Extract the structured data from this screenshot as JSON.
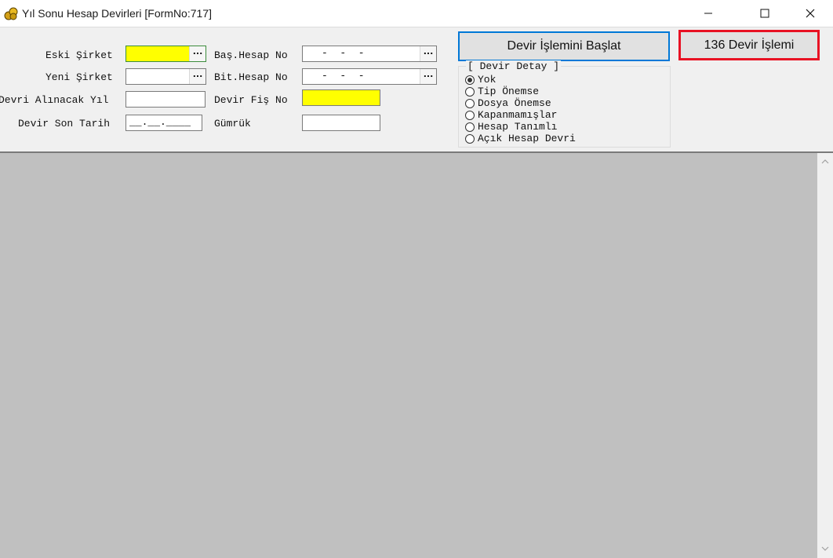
{
  "window": {
    "title": "Yıl Sonu Hesap Devirleri [FormNo:717]",
    "minimize_glyph": "—",
    "maximize_glyph": "☐",
    "close_glyph": "✕"
  },
  "form": {
    "eski_sirket_label": "Eski Şirket",
    "yeni_sirket_label": "Yeni Şirket",
    "devri_alinacak_yil_label": "Devri Alınacak Yıl",
    "devir_son_tarih_label": "Devir Son Tarih",
    "devir_son_tarih_value": "__.__.____",
    "bas_hesap_no_label": "Baş.Hesap No",
    "bas_hesap_no_value": "-  -  -",
    "bit_hesap_no_label": "Bit.Hesap No",
    "bit_hesap_no_value": "-  -  -",
    "devir_fis_no_label": "Devir Fiş No",
    "gumruk_label": "Gümrük",
    "ellipsis": "..."
  },
  "buttons": {
    "start_label": "Devir İşlemini Başlat",
    "devir_136_label": "136 Devir İşlemi"
  },
  "devir_detay": {
    "legend": "[ Devir Detay ]",
    "options": [
      {
        "label": "Yok",
        "checked": true
      },
      {
        "label": "Tip Önemse",
        "checked": false
      },
      {
        "label": "Dosya Önemse",
        "checked": false
      },
      {
        "label": "Kapanmamışlar",
        "checked": false
      },
      {
        "label": "Hesap Tanımlı",
        "checked": false
      },
      {
        "label": "Açık Hesap Devri",
        "checked": false
      }
    ]
  },
  "colors": {
    "highlight_border": "#e81123",
    "required_field": "#ffff00",
    "workspace": "#c0c0c0"
  }
}
